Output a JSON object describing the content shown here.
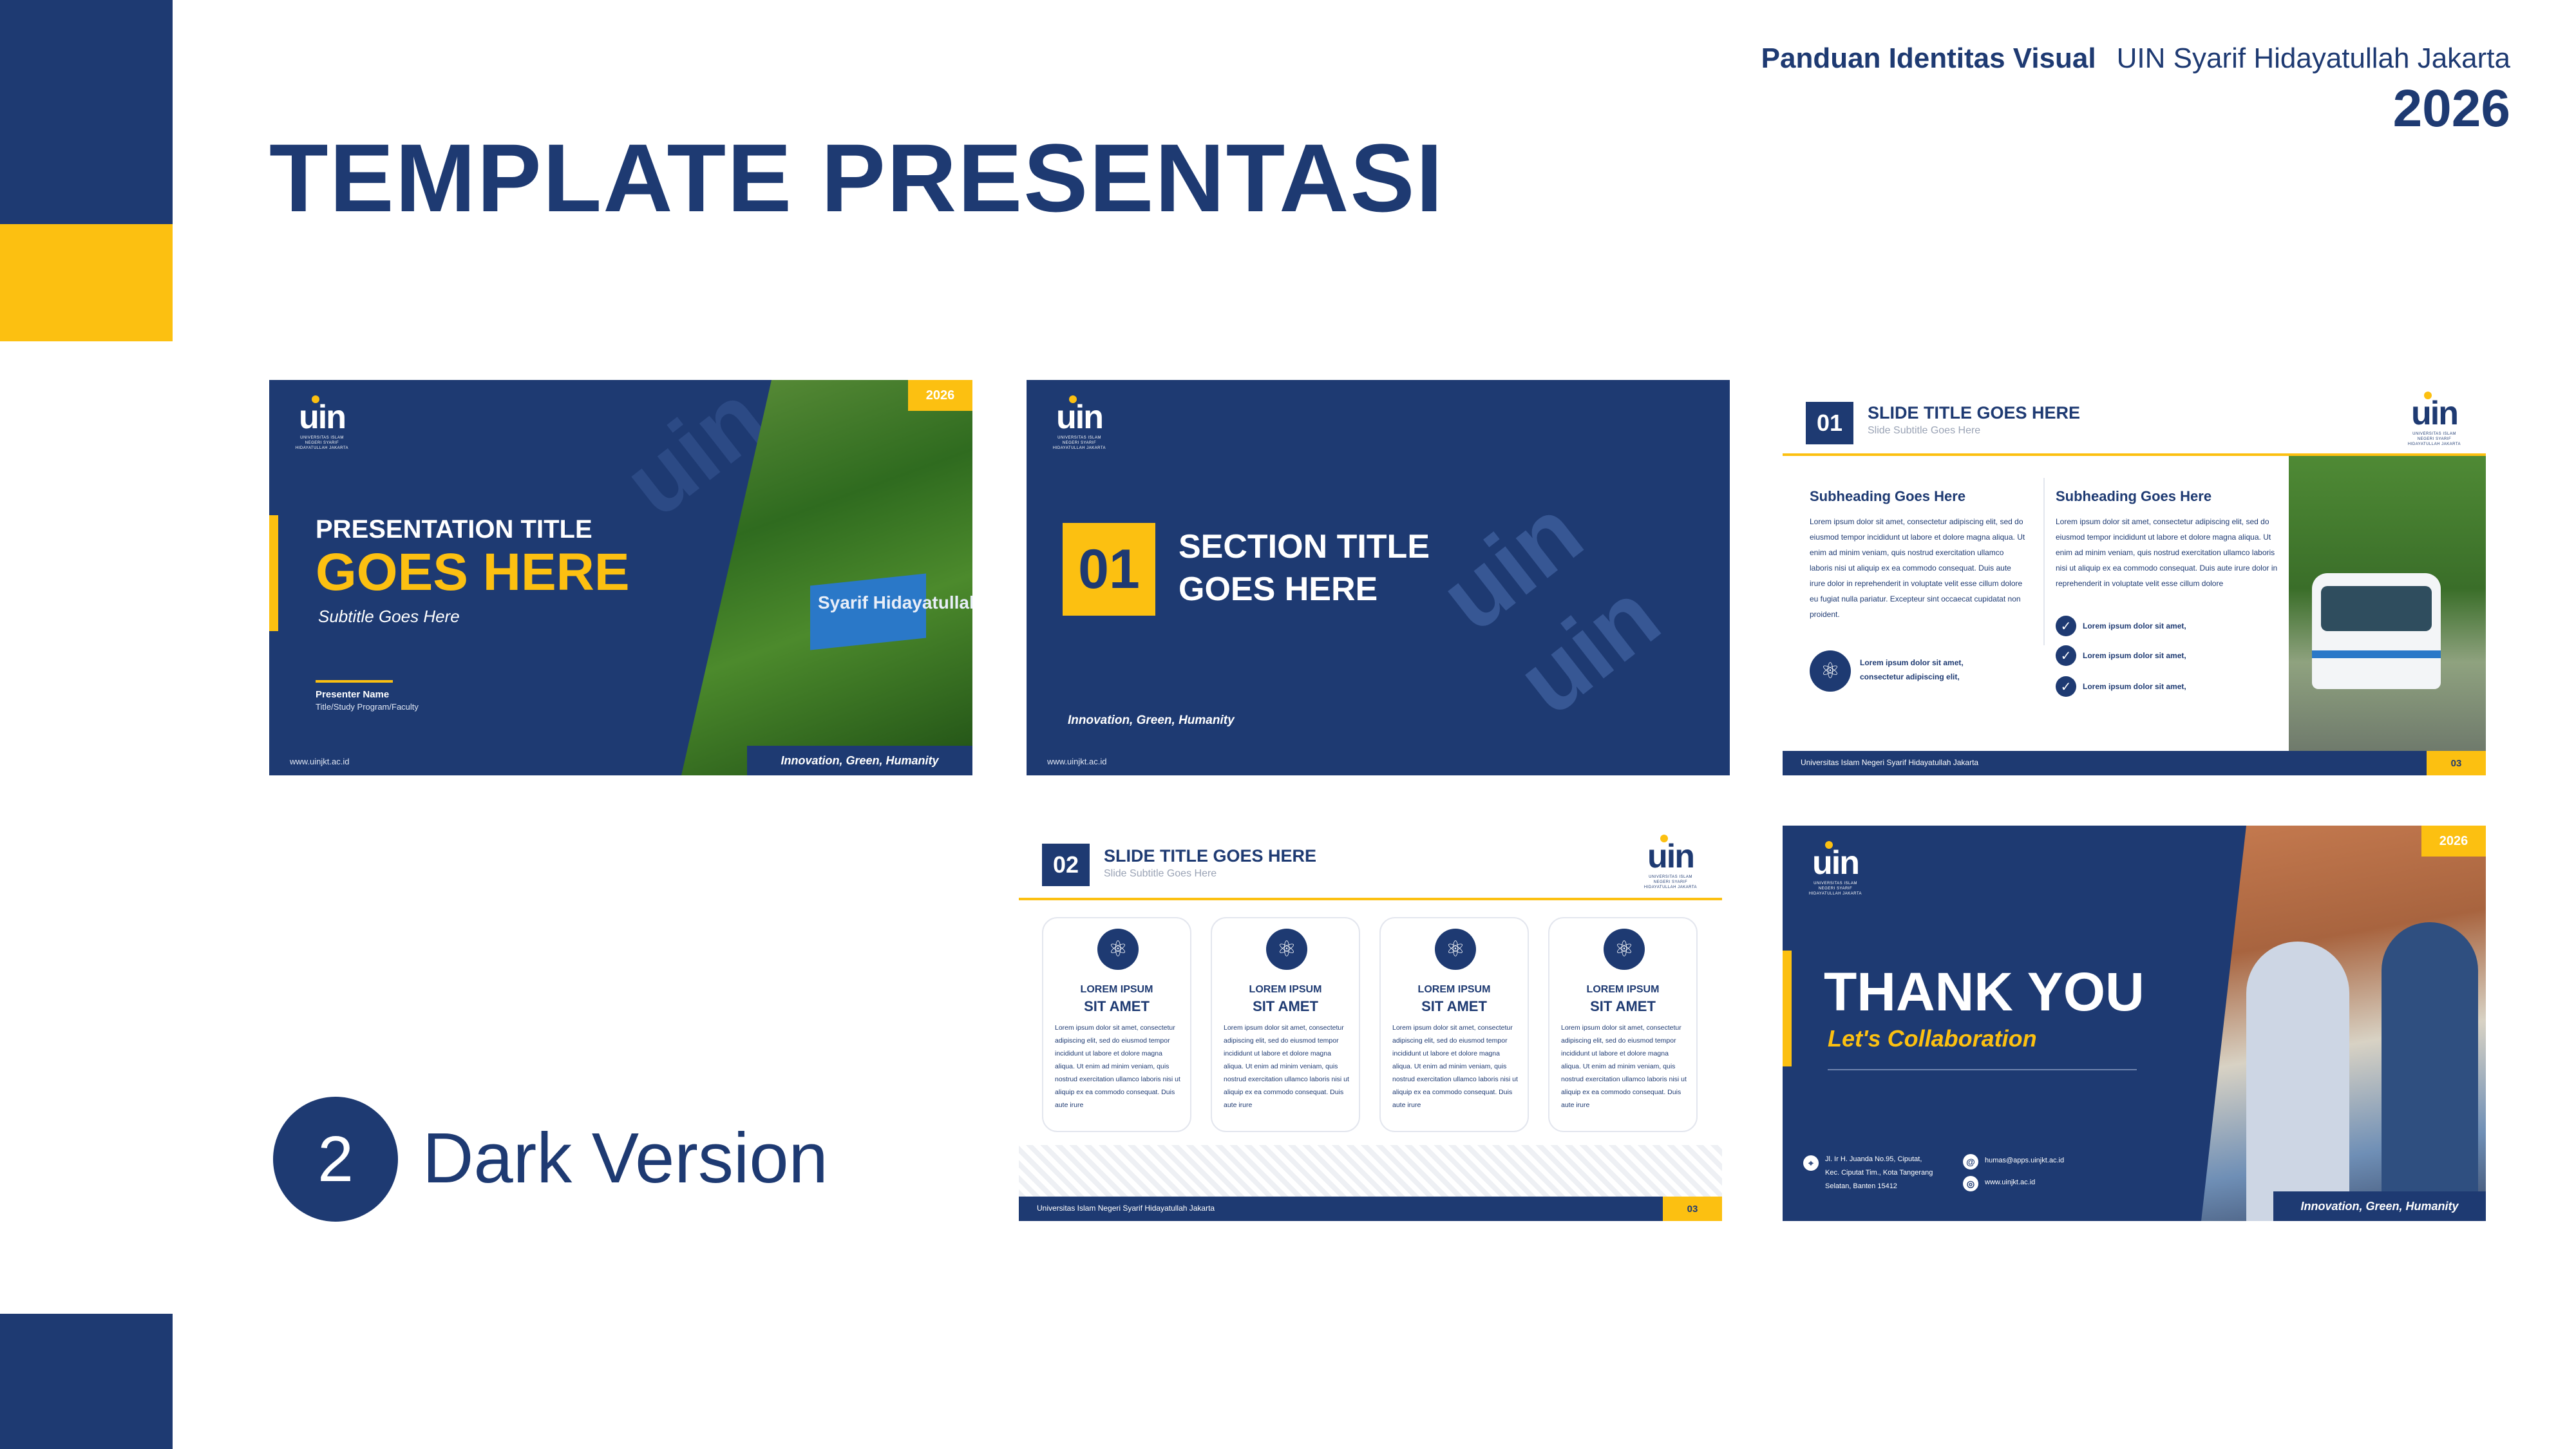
{
  "header": {
    "document": "Panduan Identitas Visual",
    "institution": "UIN Syarif Hidayatullah Jakarta",
    "year": "2026"
  },
  "page_title": "TEMPLATE PRESENTASI",
  "version": {
    "number": "2",
    "label": "Dark Version"
  },
  "colors": {
    "navy": "#1e3a72",
    "yellow": "#fcc011"
  },
  "logo": {
    "word": "uin",
    "sub": "UNIVERSITAS ISLAM NEGERI SYARIF HIDAYATULLAH JAKARTA"
  },
  "slide1": {
    "year": "2026",
    "title_line1": "PRESENTATION TITLE",
    "title_line2": "GOES HERE",
    "subtitle": "Subtitle Goes Here",
    "presenter": "Presenter Name",
    "program": "Title/Study Program/Faculty",
    "url": "www.uinjkt.ac.id",
    "tagline": "Innovation, Green, Humanity",
    "photo_sign": "Syarif Hidayatullah Jakarta"
  },
  "slide2": {
    "number": "01",
    "title_line1": "SECTION TITLE",
    "title_line2": "GOES HERE",
    "tagline": "Innovation, Green, Humanity",
    "url": "www.uinjkt.ac.id"
  },
  "slide3": {
    "number": "01",
    "title": "SLIDE TITLE GOES HERE",
    "subtitle": "Slide Subtitle Goes Here",
    "left_heading": "Subheading Goes Here",
    "left_body": "Lorem ipsum dolor sit amet, consectetur adipiscing elit, sed do eiusmod tempor incididunt ut labore et dolore magna aliqua. Ut enim ad minim veniam, quis nostrud exercitation ullamco laboris nisi ut aliquip ex ea commodo consequat. Duis aute irure dolor in reprehenderit in voluptate velit esse cillum dolore eu fugiat nulla pariatur. Excepteur sint occaecat cupidatat non proident.",
    "icon_line1": "Lorem ipsum dolor sit amet,",
    "icon_line2": "consectetur adipiscing elit,",
    "right_heading": "Subheading Goes Here",
    "right_body": "Lorem ipsum dolor sit amet, consectetur adipiscing elit, sed do eiusmod tempor incididunt ut labore et dolore magna aliqua. Ut enim ad minim veniam, quis nostrud exercitation ullamco laboris nisi ut aliquip ex ea commodo consequat. Duis aute irure dolor in reprehenderit in voluptate velit esse cillum dolore",
    "checklist": [
      "Lorem ipsum dolor sit amet,",
      "Lorem ipsum dolor sit amet,",
      "Lorem ipsum dolor sit amet,"
    ],
    "footer": "Universitas Islam Negeri Syarif Hidayatullah Jakarta",
    "page": "03"
  },
  "slide4": {
    "number": "02",
    "title": "SLIDE TITLE GOES HERE",
    "subtitle": "Slide Subtitle Goes Here",
    "cards": [
      {
        "title1": "LOREM IPSUM",
        "title2": "SIT AMET",
        "body": "Lorem ipsum dolor sit amet, consectetur adipiscing elit, sed do eiusmod tempor incididunt ut labore et dolore magna aliqua. Ut enim ad minim veniam, quis nostrud exercitation ullamco laboris nisi ut aliquip ex ea commodo consequat. Duis aute irure"
      },
      {
        "title1": "LOREM IPSUM",
        "title2": "SIT AMET",
        "body": "Lorem ipsum dolor sit amet, consectetur adipiscing elit, sed do eiusmod tempor incididunt ut labore et dolore magna aliqua. Ut enim ad minim veniam, quis nostrud exercitation ullamco laboris nisi ut aliquip ex ea commodo consequat. Duis aute irure"
      },
      {
        "title1": "LOREM IPSUM",
        "title2": "SIT AMET",
        "body": "Lorem ipsum dolor sit amet, consectetur adipiscing elit, sed do eiusmod tempor incididunt ut labore et dolore magna aliqua. Ut enim ad minim veniam, quis nostrud exercitation ullamco laboris nisi ut aliquip ex ea commodo consequat. Duis aute irure"
      },
      {
        "title1": "LOREM IPSUM",
        "title2": "SIT AMET",
        "body": "Lorem ipsum dolor sit amet, consectetur adipiscing elit, sed do eiusmod tempor incididunt ut labore et dolore magna aliqua. Ut enim ad minim veniam, quis nostrud exercitation ullamco laboris nisi ut aliquip ex ea commodo consequat. Duis aute irure"
      }
    ],
    "footer": "Universitas Islam Negeri Syarif Hidayatullah Jakarta",
    "page": "03"
  },
  "slide5": {
    "year": "2026",
    "title": "THANK YOU",
    "subtitle": "Let's Collaboration",
    "address_line1": "Jl. Ir H. Juanda No.95, Ciputat,",
    "address_line2": "Kec. Ciputat Tim., Kota Tangerang",
    "address_line3": "Selatan, Banten 15412",
    "email": "humas@apps.uinjkt.ac.id",
    "website": "www.uinjkt.ac.id",
    "tagline": "Innovation, Green, Humanity"
  }
}
